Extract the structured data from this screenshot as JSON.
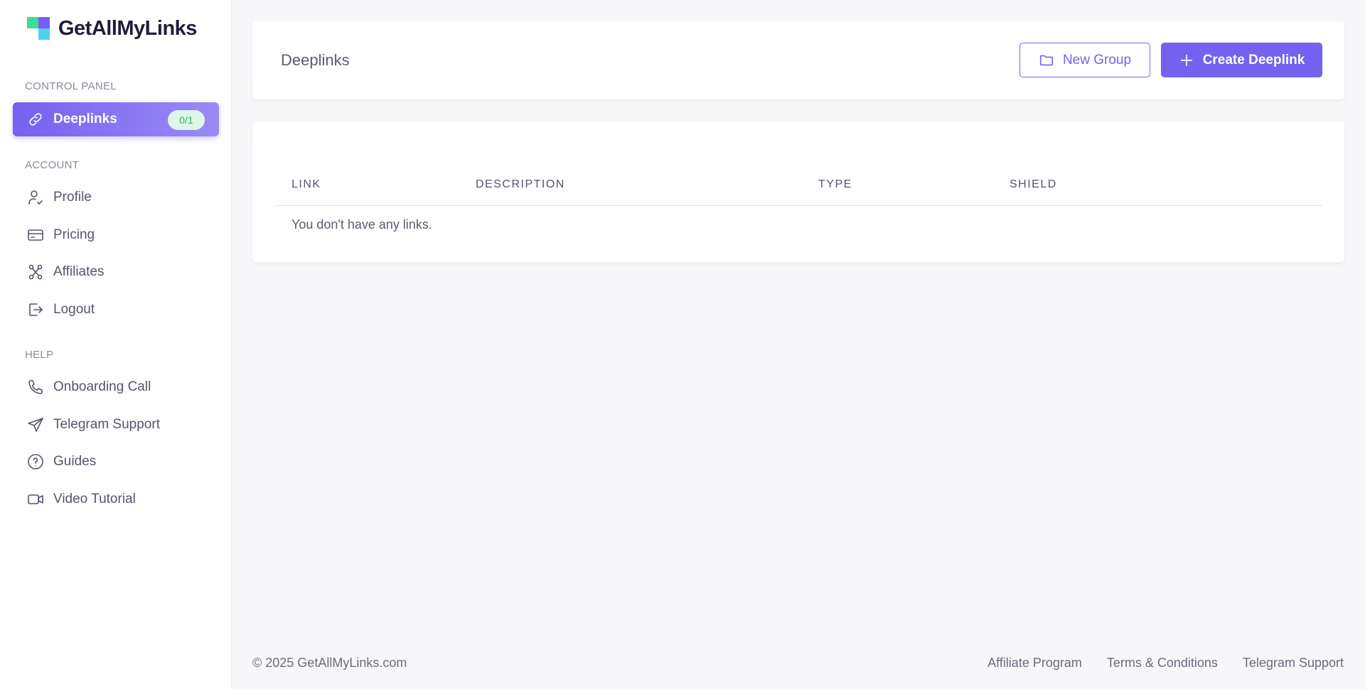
{
  "brand": {
    "name": "GetAllMyLinks"
  },
  "sidebar": {
    "sections": {
      "control_panel": "CONTROL PANEL",
      "account": "ACCOUNT",
      "help": "HELP"
    },
    "items": [
      {
        "label": "Deeplinks",
        "icon": "link-icon",
        "badge": "0/1",
        "active": true
      },
      {
        "label": "Profile",
        "icon": "user-check-icon"
      },
      {
        "label": "Pricing",
        "icon": "credit-card-icon"
      },
      {
        "label": "Affiliates",
        "icon": "share-nodes-icon"
      },
      {
        "label": "Logout",
        "icon": "logout-icon"
      },
      {
        "label": "Onboarding Call",
        "icon": "phone-icon"
      },
      {
        "label": "Telegram Support",
        "icon": "send-icon"
      },
      {
        "label": "Guides",
        "icon": "help-circle-icon"
      },
      {
        "label": "Video Tutorial",
        "icon": "video-icon"
      }
    ]
  },
  "header": {
    "title": "Deeplinks",
    "new_group_label": "New Group",
    "create_label": "Create Deeplink"
  },
  "table": {
    "columns": [
      "LINK",
      "DESCRIPTION",
      "TYPE",
      "SHIELD"
    ],
    "empty_message": "You don't have any links."
  },
  "footer": {
    "copyright": "© 2025 GetAllMyLinks.com",
    "links": [
      "Affiliate Program",
      "Terms & Conditions",
      "Telegram Support"
    ]
  },
  "colors": {
    "accent": "#7561ef",
    "badge_bg": "#dcf7e6",
    "badge_text": "#28b463"
  }
}
